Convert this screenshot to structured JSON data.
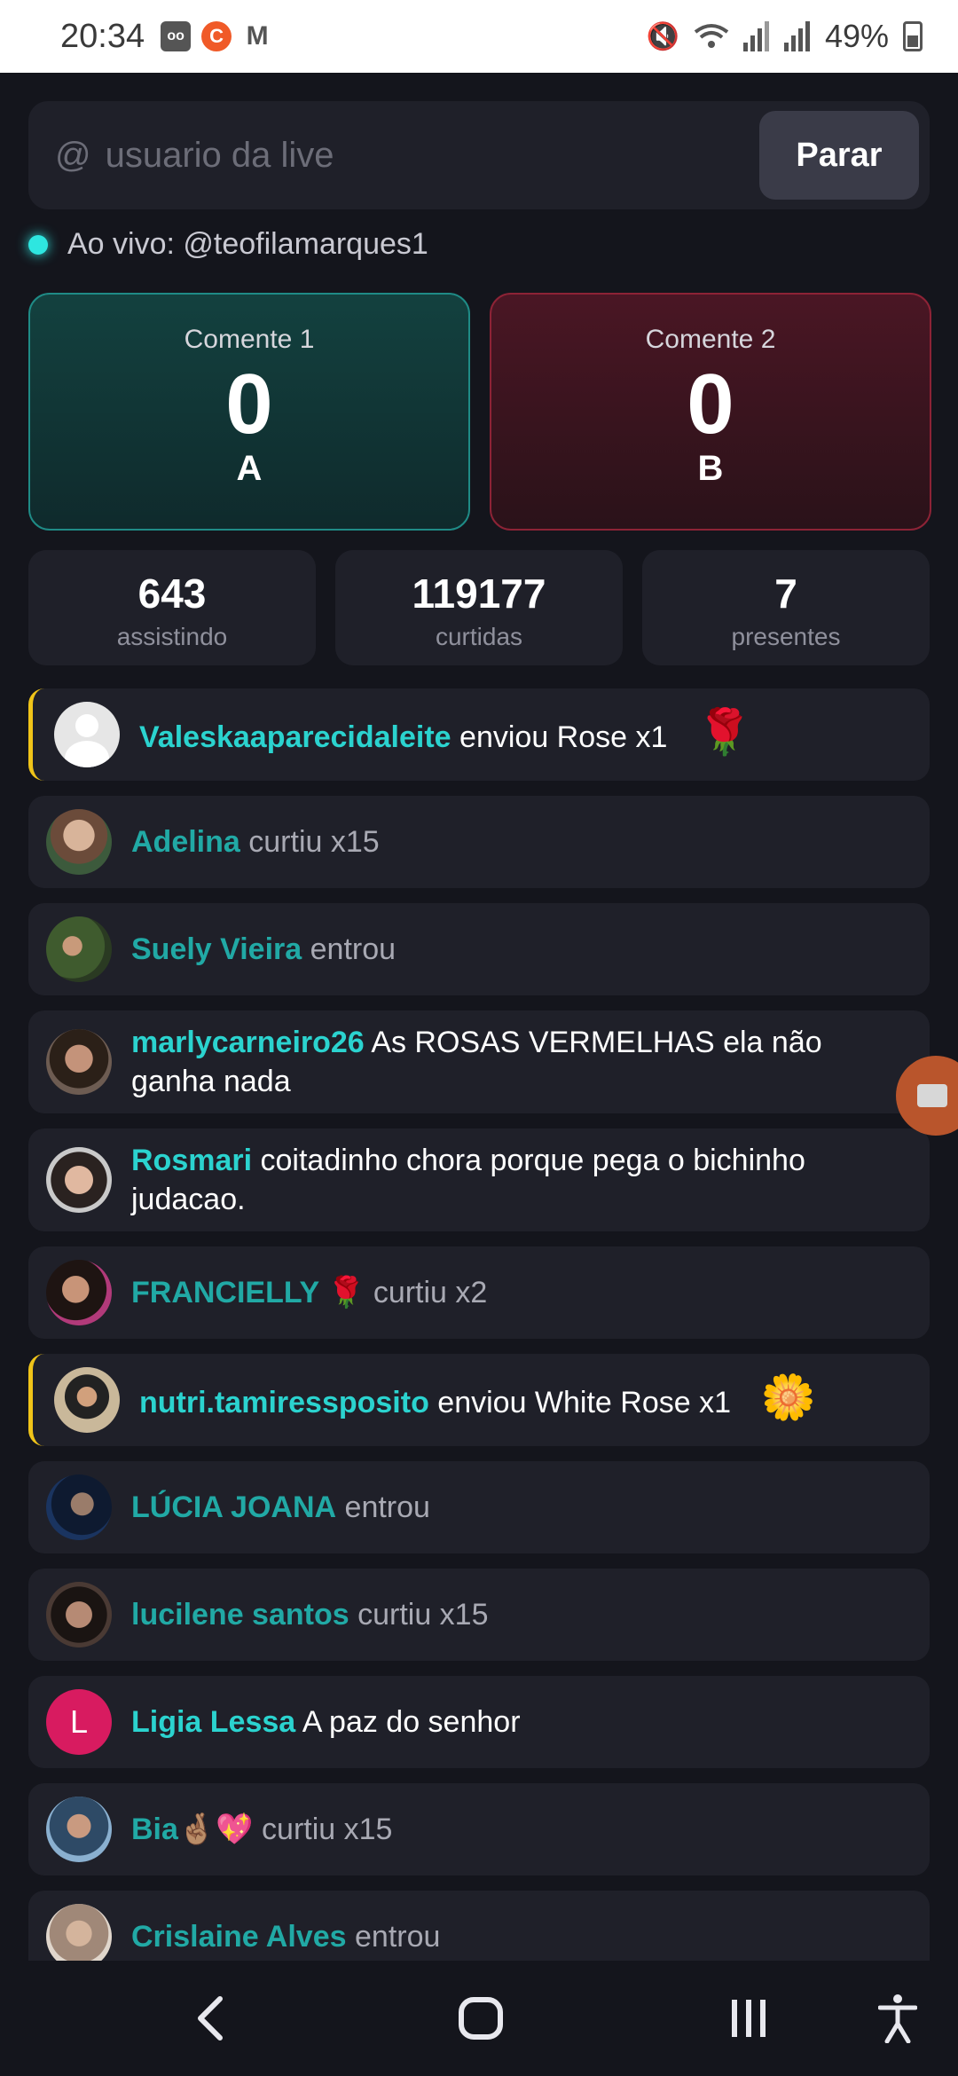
{
  "status_bar": {
    "time": "20:34",
    "battery": "49%"
  },
  "search": {
    "prefix": "@",
    "placeholder": "usuario da live",
    "value": "",
    "stop_label": "Parar"
  },
  "live": {
    "text": "Ao vivo: @teofilamarques1"
  },
  "votes": [
    {
      "label": "Comente 1",
      "count": "0",
      "letter": "A"
    },
    {
      "label": "Comente 2",
      "count": "0",
      "letter": "B"
    }
  ],
  "stats": [
    {
      "value": "643",
      "label": "assistindo"
    },
    {
      "value": "119177",
      "label": "curtidas"
    },
    {
      "value": "7",
      "label": "presentes"
    }
  ],
  "feed": [
    {
      "user": "Valeskaaparecidaleite",
      "text": "enviou Rose x1",
      "kind": "gift",
      "emoji": "🌹"
    },
    {
      "user": "Adelina",
      "text": "curtiu x15",
      "kind": "like"
    },
    {
      "user": "Suely Vieira",
      "text": "entrou",
      "kind": "join"
    },
    {
      "user": "marlycarneiro26",
      "text": "As ROSAS VERMELHAS ela não ganha nada",
      "kind": "comment"
    },
    {
      "user": "Rosmari",
      "text": "coitadinho chora porque pega o bichinho judacao.",
      "kind": "comment"
    },
    {
      "user": "FRANCIELLY 🌹",
      "text": "curtiu x2",
      "kind": "like"
    },
    {
      "user": "nutri.tamiressposito",
      "text": "enviou White Rose x1",
      "kind": "gift",
      "emoji": "🌼"
    },
    {
      "user": "LÚCIA JOANA",
      "text": "entrou",
      "kind": "join"
    },
    {
      "user": "lucilene santos",
      "text": "curtiu x15",
      "kind": "like"
    },
    {
      "user": "Ligia Lessa",
      "text": "A paz do senhor",
      "kind": "comment",
      "avatar_letter": "L"
    },
    {
      "user": "Bia🤞🏽💖",
      "text": "curtiu x15",
      "kind": "like"
    },
    {
      "user": "Crislaine Alves",
      "text": "entrou",
      "kind": "join"
    }
  ]
}
